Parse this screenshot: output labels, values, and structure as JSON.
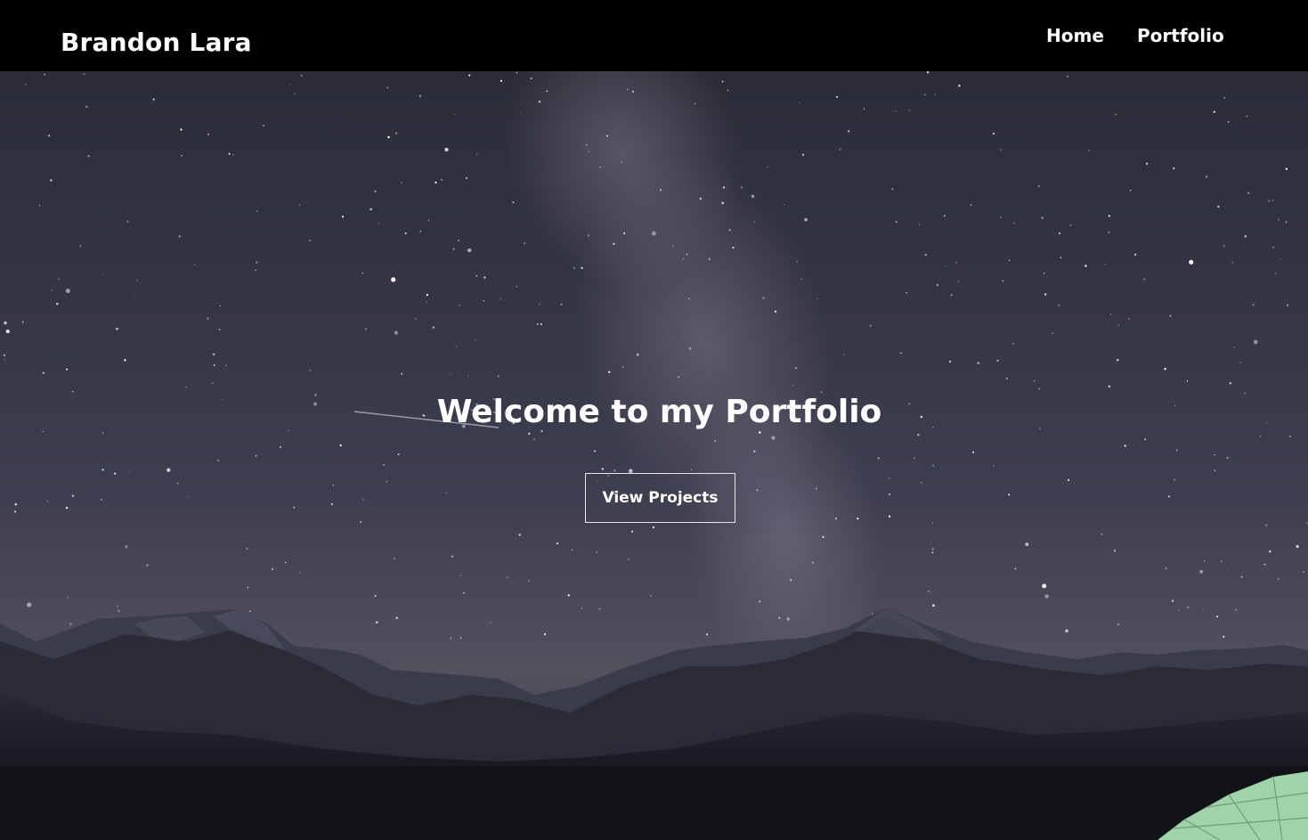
{
  "brand": {
    "name": "Brandon Lara"
  },
  "nav": {
    "home_label": "Home",
    "portfolio_label": "Portfolio"
  },
  "hero": {
    "title": "Welcome to my Portfolio",
    "button_label": "View Projects"
  },
  "colors": {
    "navbar": "#000000",
    "sky_top": "#2b2c38",
    "sky_mid": "#4a4a5e",
    "mountains": "#1c1d25",
    "foreground": "#121318",
    "tent": "#9fd4a8",
    "text": "#ffffff"
  }
}
